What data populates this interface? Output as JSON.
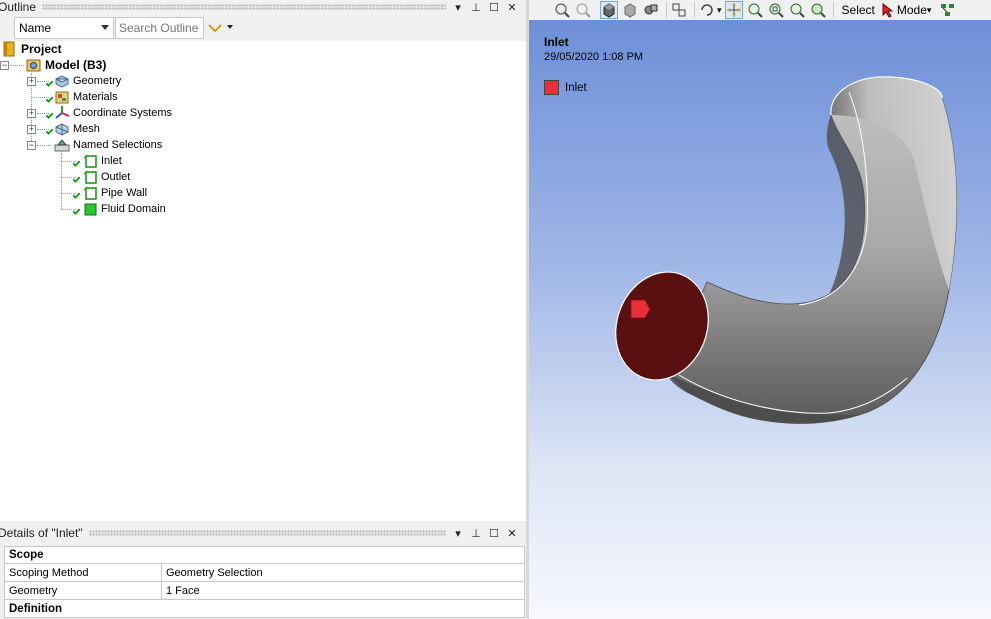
{
  "outline": {
    "title": "Outline",
    "name_select": "Name",
    "search_placeholder": "Search Outline",
    "tree": {
      "project": "Project",
      "model": "Model (B3)",
      "geometry": "Geometry",
      "materials": "Materials",
      "coordinate_systems": "Coordinate Systems",
      "mesh": "Mesh",
      "named_selections": "Named Selections",
      "inlet": "Inlet",
      "outlet": "Outlet",
      "pipe_wall": "Pipe Wall",
      "fluid_domain": "Fluid Domain"
    }
  },
  "details": {
    "title": "Details of \"Inlet\"",
    "sections": [
      {
        "name": "Scope",
        "rows": [
          {
            "key": "Scoping Method",
            "value": "Geometry Selection"
          },
          {
            "key": "Geometry",
            "value": "1 Face"
          }
        ]
      },
      {
        "name": "Definition",
        "rows": []
      }
    ]
  },
  "toolbar": {
    "select_label": "Select",
    "mode_label": "Mode"
  },
  "viewport": {
    "title": "Inlet",
    "date": "29/05/2020 1:08 PM",
    "legend": [
      {
        "label": "Inlet",
        "color": "#e8303a"
      }
    ],
    "colors": {
      "selected_face": "#5a1010",
      "legend": "#e8303a",
      "pipe_light": "#c8c8c8",
      "pipe_dark": "#6c6c6c"
    }
  },
  "panel_controls": {
    "pin": "⊥",
    "close": "✕"
  }
}
